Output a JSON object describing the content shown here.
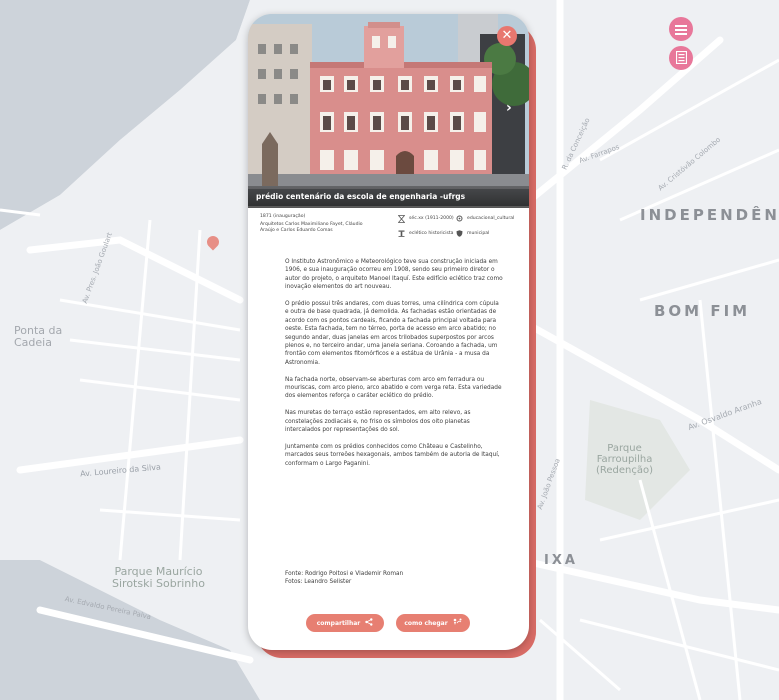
{
  "map": {
    "labels": {
      "independencia": "INDEPENDÊN",
      "bom_fim": "BOM FIM",
      "ponta_cadeia": "Ponta da\nCadeia",
      "parque_farroupilha": "Parque\nFarroupilha\n(Redenção)",
      "parque_mauricio": "Parque Maurício\nSirotski Sobrinho",
      "av_loureiro": "Av. Loureiro da Silva",
      "av_farrapos": "Av. Farrapos",
      "av_cristovao": "Av. Cristóvão Colombo",
      "r_conceicao": "R. da Conceição",
      "av_osvaldo": "Av. Osvaldo Aranha",
      "av_edvaldo": "Av. Edvaldo Pereira Paiva",
      "av_joao_pessoa": "Av. João Pessoa",
      "av_pres_joao": "Av. Pres. João Goulart",
      "ixa": "IXA"
    },
    "menu_icon": "menu-icon",
    "list_icon": "list-icon"
  },
  "modal": {
    "caption": "prédio centenário da escola de engenharia -ufrgs",
    "close_icon": "close-icon",
    "next_icon": "chevron-right-icon",
    "meta": {
      "inauguration": "1871 (inauguração)",
      "architects": "Arquitetos Carlos Maximiliano Fayet, Cláudio Araújo e Carlos Eduardo Comas",
      "period": "séc.xx (1911-2000)",
      "style": "eclético historicista",
      "category": "educacional_cultural",
      "ownership": "municipal"
    },
    "paragraphs": [
      "O Instituto Astronômico e Meteorológico teve sua construção iniciada em 1906, e sua inauguração ocorreu em 1908, sendo seu primeiro diretor o autor do projeto, o arquiteto Manoel Itaquí. Este edifício eclético traz como inovação elementos do art nouveau.",
      "O prédio possui três andares, com duas torres, uma cilíndrica com cúpula e outra de base quadrada, já demolida. As fachadas estão orientadas de acordo com os pontos cardeais, ficando a fachada principal voltada para oeste. Esta fachada, tem no térreo, porta de acesso em arco abatido; no segundo andar, duas janelas em arcos trilobados superpostos por arcos plenos e, no terceiro andar, uma janela seriana. Coroando a fachada, um frontão com elementos fitomórficos e a estátua de Urânia - a musa da Astronomia.",
      "Na fachada norte, observam-se aberturas com arco em ferradura ou mouriscas, com arco pleno, arco abatido e com verga reta. Esta variedade dos elementos reforça o caráter eclético do prédio.",
      "Nas muretas do terraço estão representados, em alto relevo, as constelações zodiacais e, no friso os símbolos dos oito planetas intercalados por representações do sol.",
      "Juntamente com os prédios conhecidos como Château e Castelinho, marcados seus torreões hexagonais, ambos também de autoria de Itaquí, conformam o Largo Paganini."
    ],
    "source": "Fonte: Rodrigo Poltosi e Vlademir Roman",
    "photos": "Fotos: Leandro Selister",
    "share_label": "compartilhar",
    "share_icon": "share-icon",
    "directions_label": "como chegar",
    "directions_icon": "directions-icon"
  },
  "colors": {
    "accent": "#e77f72",
    "map_button": "#e8779a",
    "modal_shadow": "#d96c66"
  }
}
